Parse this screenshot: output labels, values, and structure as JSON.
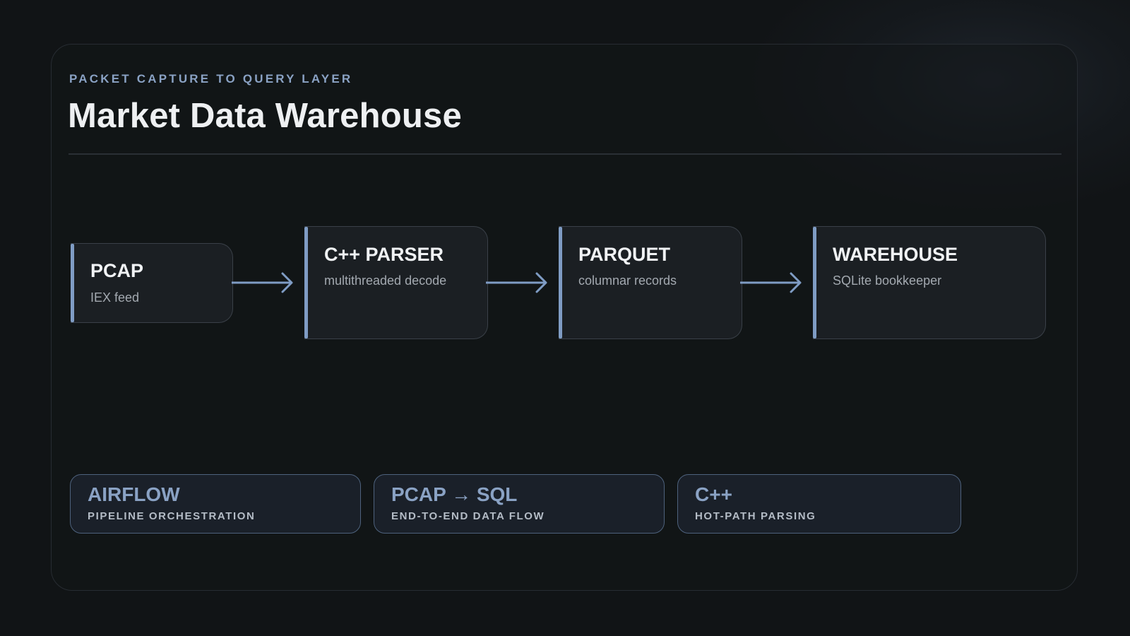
{
  "header": {
    "eyebrow": "PACKET CAPTURE TO QUERY LAYER",
    "title": "Market Data Warehouse"
  },
  "pipeline": {
    "nodes": [
      {
        "title": "PCAP",
        "subtitle": "IEX feed"
      },
      {
        "title": "C++ PARSER",
        "subtitle": "multithreaded decode"
      },
      {
        "title": "PARQUET",
        "subtitle": "columnar records"
      },
      {
        "title": "WAREHOUSE",
        "subtitle": "SQLite bookkeeper"
      }
    ]
  },
  "tags": [
    {
      "title": "AIRFLOW",
      "subtitle": "PIPELINE ORCHESTRATION"
    },
    {
      "title": "PCAP → SQL",
      "subtitle": "END-TO-END DATA FLOW"
    },
    {
      "title": "C++",
      "subtitle": "HOT-PATH PARSING"
    }
  ],
  "colors": {
    "background": "#111416",
    "accent": "#7f9cc4",
    "text": "#eef0f2",
    "muted": "#a3a9b0"
  }
}
